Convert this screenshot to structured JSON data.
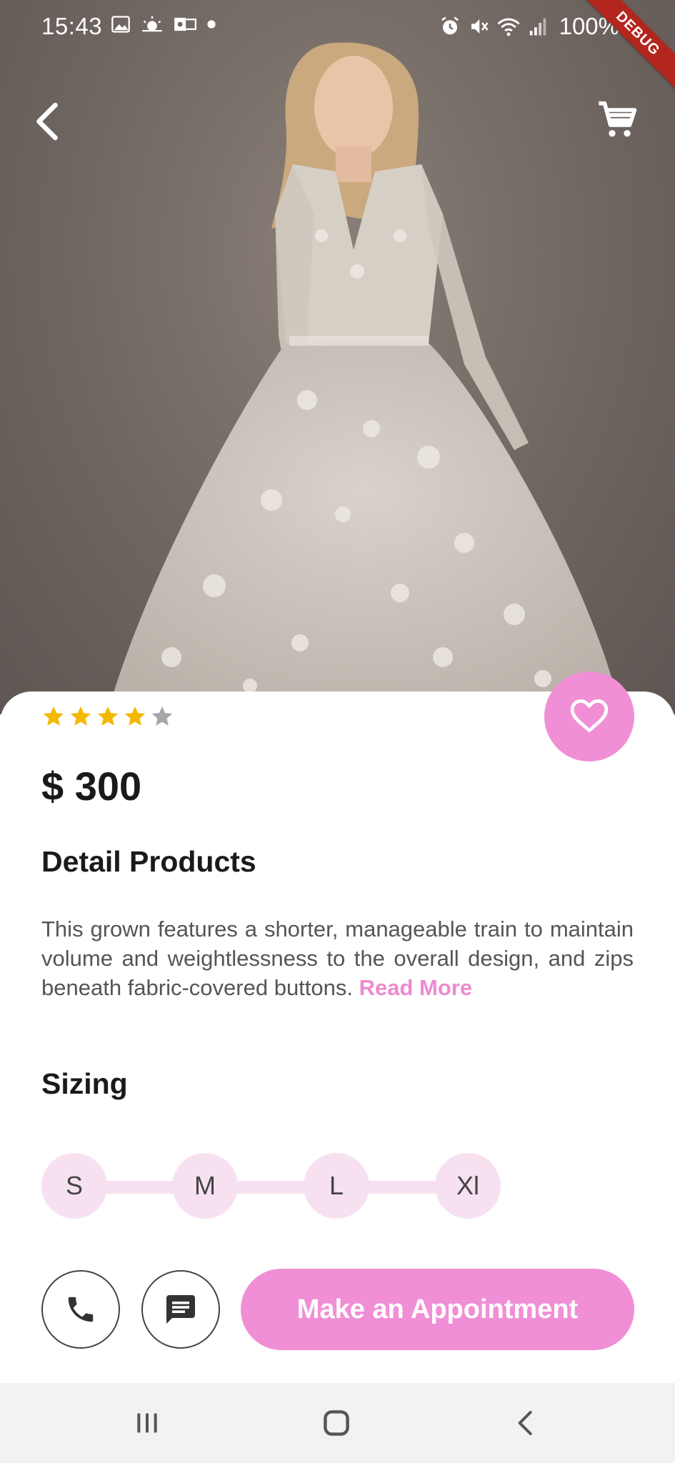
{
  "status_bar": {
    "time": "15:43",
    "battery": "100%",
    "icons_left": [
      "image-icon",
      "weather-icon",
      "outlook-icon",
      "dot-icon"
    ],
    "icons_right": [
      "alarm-icon",
      "mute-icon",
      "wifi-icon",
      "signal-icon",
      "battery-icon"
    ]
  },
  "debug_banner": "DEBUG",
  "header": {
    "back_icon": "chevron-left-icon",
    "cart_icon": "cart-icon"
  },
  "product": {
    "rating": 4,
    "rating_max": 5,
    "price": "$ 300",
    "detail_title": "Detail Products",
    "description": "This grown features a shorter, manageable train to maintain volume and weightlessness to the overall design, and zips beneath fabric-covered buttons.",
    "read_more": "Read More",
    "sizing_title": "Sizing",
    "sizes": [
      "S",
      "M",
      "L",
      "Xl"
    ]
  },
  "actions": {
    "call_icon": "phone-icon",
    "message_icon": "message-icon",
    "appointment_label": "Make an Appointment",
    "favorite_icon": "heart-icon"
  },
  "colors": {
    "accent": "#f08fd5",
    "accent_light": "#f7e1f1",
    "star_filled": "#f5b800",
    "star_empty": "#a6a6a6"
  },
  "nav_bar": [
    "recents-icon",
    "home-icon",
    "back-icon"
  ]
}
